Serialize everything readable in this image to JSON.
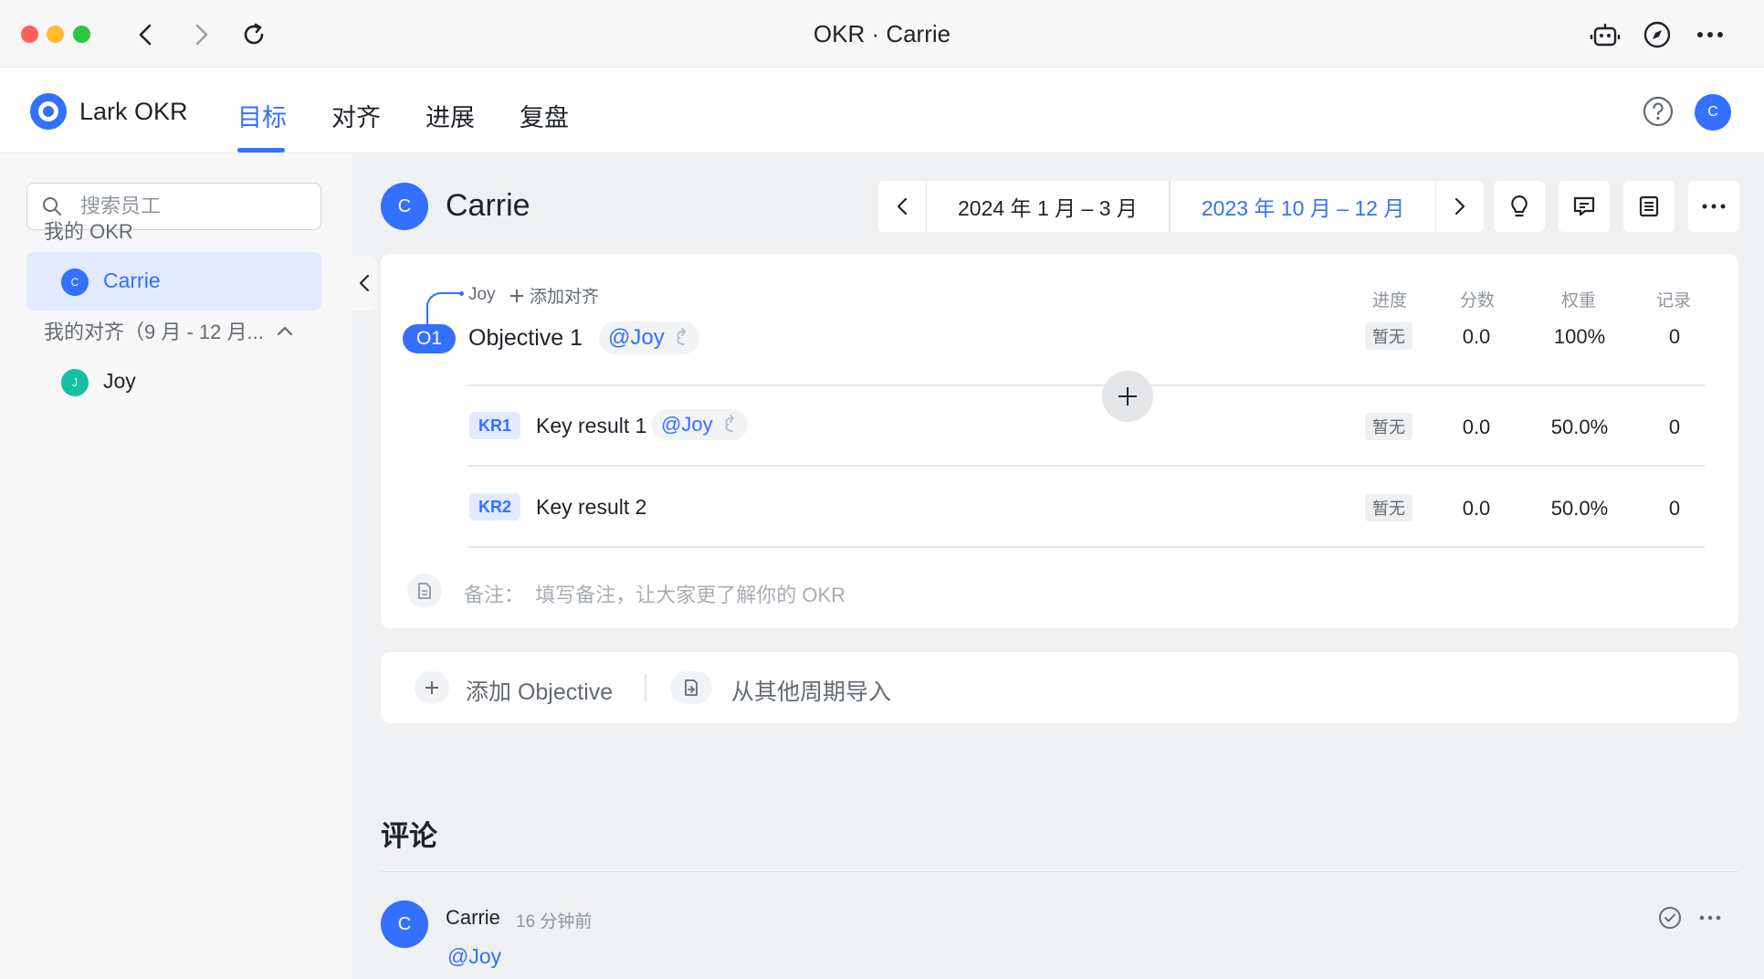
{
  "window": {
    "title": "OKR · Carrie"
  },
  "appnav": {
    "brand": "Lark OKR",
    "tabs": [
      {
        "label": "目标",
        "active": true
      },
      {
        "label": "对齐",
        "active": false
      },
      {
        "label": "进展",
        "active": false
      },
      {
        "label": "复盘",
        "active": false
      }
    ],
    "user_initial": "C"
  },
  "sidebar": {
    "search_placeholder": "搜索员工",
    "my_okr_heading": "我的 OKR",
    "my_okr_items": [
      {
        "initial": "C",
        "name": "Carrie",
        "active": true
      }
    ],
    "alignment_heading": "我的对齐（9 月 - 12 月...",
    "alignment_items": [
      {
        "initial": "J",
        "name": "Joy"
      }
    ]
  },
  "header": {
    "owner_initial": "C",
    "owner_name": "Carrie",
    "periods": [
      {
        "label": "2024 年 1 月 – 3 月",
        "active": false
      },
      {
        "label": "2023 年 10 月 – 12 月",
        "active": true
      }
    ]
  },
  "okr": {
    "aligned_to": "Joy",
    "add_alignment": "添加对齐",
    "columns": [
      "进度",
      "分数",
      "权重",
      "记录"
    ],
    "objective": {
      "badge": "O1",
      "title": "Objective 1",
      "mention": "@Joy",
      "progress": "暂无",
      "score": "0.0",
      "weight": "100%",
      "records": "0"
    },
    "key_results": [
      {
        "badge": "KR1",
        "title": "Key result 1",
        "mention": "@Joy",
        "progress": "暂无",
        "score": "0.0",
        "weight": "50.0%",
        "records": "0"
      },
      {
        "badge": "KR2",
        "title": "Key result 2",
        "mention": "",
        "progress": "暂无",
        "score": "0.0",
        "weight": "50.0%",
        "records": "0"
      }
    ],
    "note": "备注：  填写备注，让大家更了解你的 OKR"
  },
  "actions": {
    "add_objective": "添加 Objective",
    "import_from_period": "从其他周期导入"
  },
  "comments": {
    "title": "评论",
    "items": [
      {
        "initial": "C",
        "author": "Carrie",
        "time": "16 分钟前",
        "body": "@Joy"
      }
    ]
  },
  "colors": {
    "accent": "#3370ff",
    "joy_avatar": "#14c0a3"
  }
}
